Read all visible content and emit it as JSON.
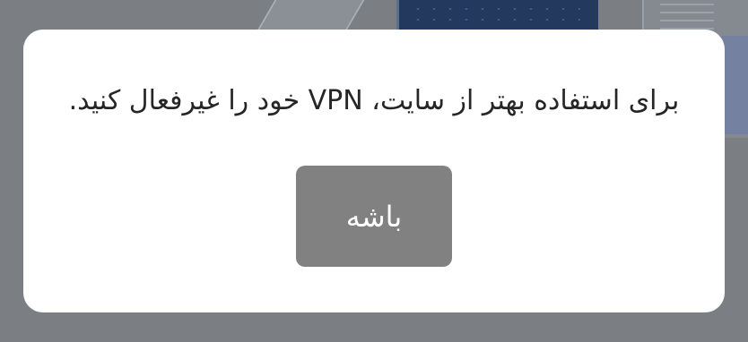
{
  "dialog": {
    "message": "برای استفاده بهتر از سایت، VPN خود را غیرفعال کنید.",
    "ok_label": "باشه"
  },
  "colors": {
    "overlay": "#7b7e82",
    "dialog_background": "#ffffff",
    "button_background": "#818181",
    "button_text": "#ffffff",
    "message_text": "#262626"
  }
}
